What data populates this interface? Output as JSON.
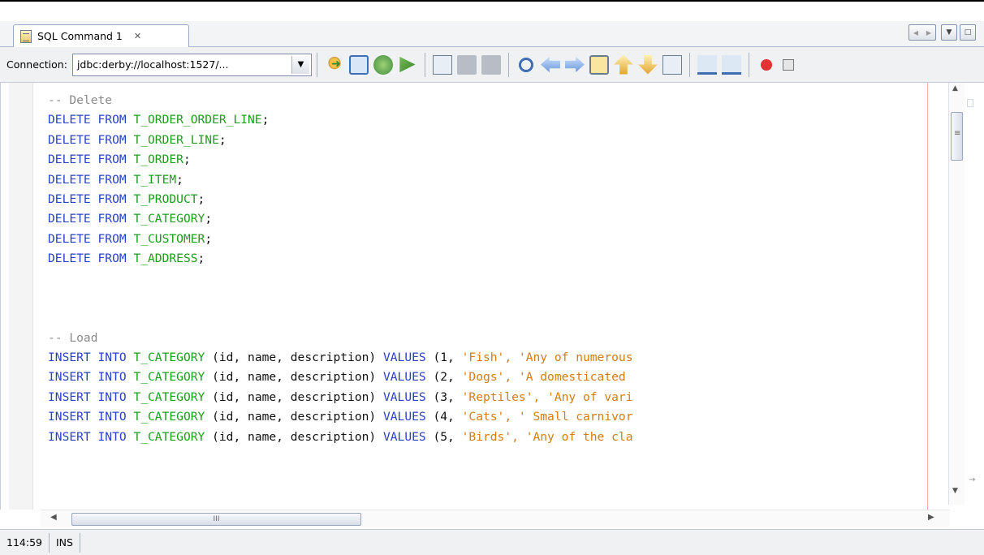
{
  "tab": {
    "title": "SQL Command 1",
    "close_glyph": "✕"
  },
  "window_buttons": {
    "prev": "◀",
    "next": "▶",
    "dropdown": "▼",
    "maximize": "□"
  },
  "toolbar": {
    "connection_label": "Connection:",
    "connection_value": "jdbc:derby://localhost:1527/...",
    "dropdown_glyph": "▼",
    "icons": [
      "run-sql-icon",
      "execute-icon",
      "history-icon",
      "run-file-icon",
      "select-doc-icon",
      "format-icon",
      "format-dropdown-icon",
      "find-icon",
      "find-prev-icon",
      "find-next-icon",
      "toggle-highlight-icon",
      "prev-bookmark-icon",
      "next-bookmark-icon",
      "toggle-bookmark-icon",
      "shift-left-icon",
      "shift-right-icon",
      "record-macro-icon",
      "stop-macro-icon"
    ]
  },
  "editor": {
    "lines": [
      {
        "tokens": [
          {
            "t": "-- Delete",
            "c": "cm"
          }
        ]
      },
      {
        "tokens": [
          {
            "t": "DELETE FROM ",
            "c": "kw"
          },
          {
            "t": "T_ORDER_ORDER_LINE",
            "c": "id"
          },
          {
            "t": ";",
            "c": "pl"
          }
        ]
      },
      {
        "tokens": [
          {
            "t": "DELETE FROM ",
            "c": "kw"
          },
          {
            "t": "T_ORDER_LINE",
            "c": "id"
          },
          {
            "t": ";",
            "c": "pl"
          }
        ]
      },
      {
        "tokens": [
          {
            "t": "DELETE FROM ",
            "c": "kw"
          },
          {
            "t": "T_ORDER",
            "c": "id"
          },
          {
            "t": ";",
            "c": "pl"
          }
        ]
      },
      {
        "tokens": [
          {
            "t": "DELETE FROM ",
            "c": "kw"
          },
          {
            "t": "T_ITEM",
            "c": "id"
          },
          {
            "t": ";",
            "c": "pl"
          }
        ]
      },
      {
        "tokens": [
          {
            "t": "DELETE FROM ",
            "c": "kw"
          },
          {
            "t": "T_PRODUCT",
            "c": "id"
          },
          {
            "t": ";",
            "c": "pl"
          }
        ]
      },
      {
        "tokens": [
          {
            "t": "DELETE FROM ",
            "c": "kw"
          },
          {
            "t": "T_CATEGORY",
            "c": "id"
          },
          {
            "t": ";",
            "c": "pl"
          }
        ]
      },
      {
        "tokens": [
          {
            "t": "DELETE FROM ",
            "c": "kw"
          },
          {
            "t": "T_CUSTOMER",
            "c": "id"
          },
          {
            "t": ";",
            "c": "pl"
          }
        ]
      },
      {
        "tokens": [
          {
            "t": "DELETE FROM ",
            "c": "kw"
          },
          {
            "t": "T_ADDRESS",
            "c": "id"
          },
          {
            "t": ";",
            "c": "pl"
          }
        ]
      },
      {
        "tokens": []
      },
      {
        "tokens": []
      },
      {
        "tokens": []
      },
      {
        "tokens": [
          {
            "t": "-- Load",
            "c": "cm"
          }
        ]
      },
      {
        "tokens": [
          {
            "t": "INSERT INTO ",
            "c": "kw"
          },
          {
            "t": "T_CATEGORY",
            "c": "id"
          },
          {
            "t": " (id, name, description) ",
            "c": "pl"
          },
          {
            "t": "VALUES",
            "c": "kw"
          },
          {
            "t": " (1, ",
            "c": "pl"
          },
          {
            "t": "'Fish', 'Any of numerous",
            "c": "str"
          }
        ]
      },
      {
        "tokens": [
          {
            "t": "INSERT INTO ",
            "c": "kw"
          },
          {
            "t": "T_CATEGORY",
            "c": "id"
          },
          {
            "t": " (id, name, description) ",
            "c": "pl"
          },
          {
            "t": "VALUES",
            "c": "kw"
          },
          {
            "t": " (2, ",
            "c": "pl"
          },
          {
            "t": "'Dogs', 'A domesticated",
            "c": "str"
          }
        ]
      },
      {
        "tokens": [
          {
            "t": "INSERT INTO ",
            "c": "kw"
          },
          {
            "t": "T_CATEGORY",
            "c": "id"
          },
          {
            "t": " (id, name, description) ",
            "c": "pl"
          },
          {
            "t": "VALUES",
            "c": "kw"
          },
          {
            "t": " (3, ",
            "c": "pl"
          },
          {
            "t": "'Reptiles', 'Any of vari",
            "c": "str"
          }
        ]
      },
      {
        "tokens": [
          {
            "t": "INSERT INTO ",
            "c": "kw"
          },
          {
            "t": "T_CATEGORY",
            "c": "id"
          },
          {
            "t": " (id, name, description) ",
            "c": "pl"
          },
          {
            "t": "VALUES",
            "c": "kw"
          },
          {
            "t": " (4, ",
            "c": "pl"
          },
          {
            "t": "'Cats', ' Small carnivor",
            "c": "str"
          }
        ]
      },
      {
        "tokens": [
          {
            "t": "INSERT INTO ",
            "c": "kw"
          },
          {
            "t": "T_CATEGORY",
            "c": "id"
          },
          {
            "t": " (id, name, description) ",
            "c": "pl"
          },
          {
            "t": "VALUES",
            "c": "kw"
          },
          {
            "t": " (5, ",
            "c": "pl"
          },
          {
            "t": "'Birds', 'Any of the cla",
            "c": "str"
          }
        ]
      }
    ]
  },
  "scrollbars": {
    "up": "▲",
    "down": "▼",
    "left": "◀",
    "right": "▶",
    "grip": "III"
  },
  "status": {
    "position": "114:59",
    "mode": "INS"
  },
  "colors": {
    "keyword": "#2b40c5",
    "identifier": "#1d9c1d",
    "string": "#d27d10",
    "comment": "#8a8a8a",
    "margin_line": "#f3aaaa"
  }
}
